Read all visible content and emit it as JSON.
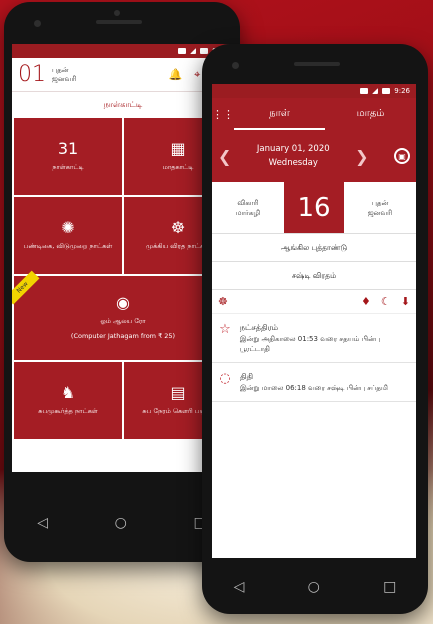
{
  "status": {
    "time": "9:26"
  },
  "phone1": {
    "day_number": "01",
    "day_line1": "புதன்",
    "day_line2": "ஜனவரி",
    "nav_link": "நாள்காட்டி",
    "tiles": [
      {
        "icon": "31",
        "label": "நாள்காட்டி"
      },
      {
        "icon": "▦",
        "label": "மாதகாட்டி"
      },
      {
        "icon": "✺",
        "label": "பண்டிகை, விடுமுறை நாட்கள்"
      },
      {
        "icon": "☸",
        "label": "முக்கிய விரத நாட்கள்"
      },
      {
        "icon": "◉",
        "label": "ஓம் ஆலய ரோ",
        "sublabel": "(Computer Jathagam from ₹ 25)",
        "badge": "New"
      },
      {
        "icon": "♞",
        "label": "சுபமுகூர்த்த நாட்கள்"
      },
      {
        "icon": "▤",
        "label": "சுப நேரம் கௌரி பஞ்சா"
      }
    ]
  },
  "phone2": {
    "tab_day": "நாள்",
    "tab_month": "மாதம்",
    "date": "January 01, 2020",
    "weekday": "Wednesday",
    "left_line1": "விகாரி",
    "left_line2": "மார்கழி",
    "big_day": "16",
    "right_line1": "புதன்",
    "right_line2": "ஜனவரி",
    "info1": "ஆங்கில புத்தாண்டு",
    "info2": "சஷ்டி விரதம்",
    "details": [
      {
        "title": "நட்சத்திரம்",
        "desc": "இன்று அதிகாலை 01:53 வரை சதயம் பின்பு பூரட்டாதி"
      },
      {
        "title": "திதி",
        "desc": "இன்று மாலை 06:18 வரை சஷ்டி பின்பு சப்தமி"
      }
    ]
  }
}
